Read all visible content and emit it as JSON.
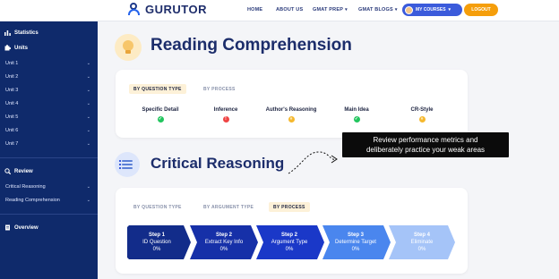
{
  "nav": {
    "logo": "GURUTOR",
    "links": [
      {
        "label": "HOME",
        "caret": false
      },
      {
        "label": "ABOUT US",
        "caret": false
      },
      {
        "label": "GMAT PREP",
        "caret": true
      },
      {
        "label": "GMAT BLOGS",
        "caret": true
      }
    ],
    "my_courses": "MY COURSES",
    "logout": "LOGOUT"
  },
  "sidebar": {
    "statistics": "Statistics",
    "units_title": "Units",
    "units": [
      "Unit 1",
      "Unit 2",
      "Unit 3",
      "Unit 4",
      "Unit 5",
      "Unit 6",
      "Unit 7"
    ],
    "review_title": "Review",
    "review_items": [
      "Critical Reasoning",
      "Reading Comprehension"
    ],
    "overview": "Overview"
  },
  "reading": {
    "title": "Reading Comprehension",
    "tabs": [
      "BY QUESTION TYPE",
      "BY PROCESS"
    ],
    "active_tab": "BY QUESTION TYPE",
    "metrics": [
      {
        "label": "Specific Detail",
        "status": "good",
        "color": "#22c55e",
        "glyph": "✓"
      },
      {
        "label": "Inference",
        "status": "weak",
        "color": "#ef4444",
        "glyph": "!"
      },
      {
        "label": "Author's Reasoning",
        "status": "average",
        "color": "#f5b82e",
        "glyph": "»"
      },
      {
        "label": "Main Idea",
        "status": "good",
        "color": "#22c55e",
        "glyph": "✓"
      },
      {
        "label": "CR-Style",
        "status": "average",
        "color": "#f5b82e",
        "glyph": "»"
      }
    ]
  },
  "critical": {
    "title": "Critical Reasoning",
    "tabs": [
      "BY QUESTION TYPE",
      "BY ARGUMENT TYPE",
      "BY PROCESS"
    ],
    "active_tab": "BY PROCESS",
    "steps": [
      {
        "step": "Step 1",
        "name": "ID Question",
        "pct": "0%",
        "color": "#122c8a"
      },
      {
        "step": "Step 2",
        "name": "Extract Key Info",
        "pct": "0%",
        "color": "#1630a8"
      },
      {
        "step": "Step 2",
        "name": "Argument Type",
        "pct": "0%",
        "color": "#1a38c8"
      },
      {
        "step": "Step 3",
        "name": "Determine Target",
        "pct": "0%",
        "color": "#4a86ee"
      },
      {
        "step": "Step 4",
        "name": "Eliminate",
        "pct": "0%",
        "color": "#a5c4f8"
      }
    ]
  },
  "tooltip": {
    "line1": "Review performance metrics and",
    "line2": "deliberately practice your weak areas"
  }
}
